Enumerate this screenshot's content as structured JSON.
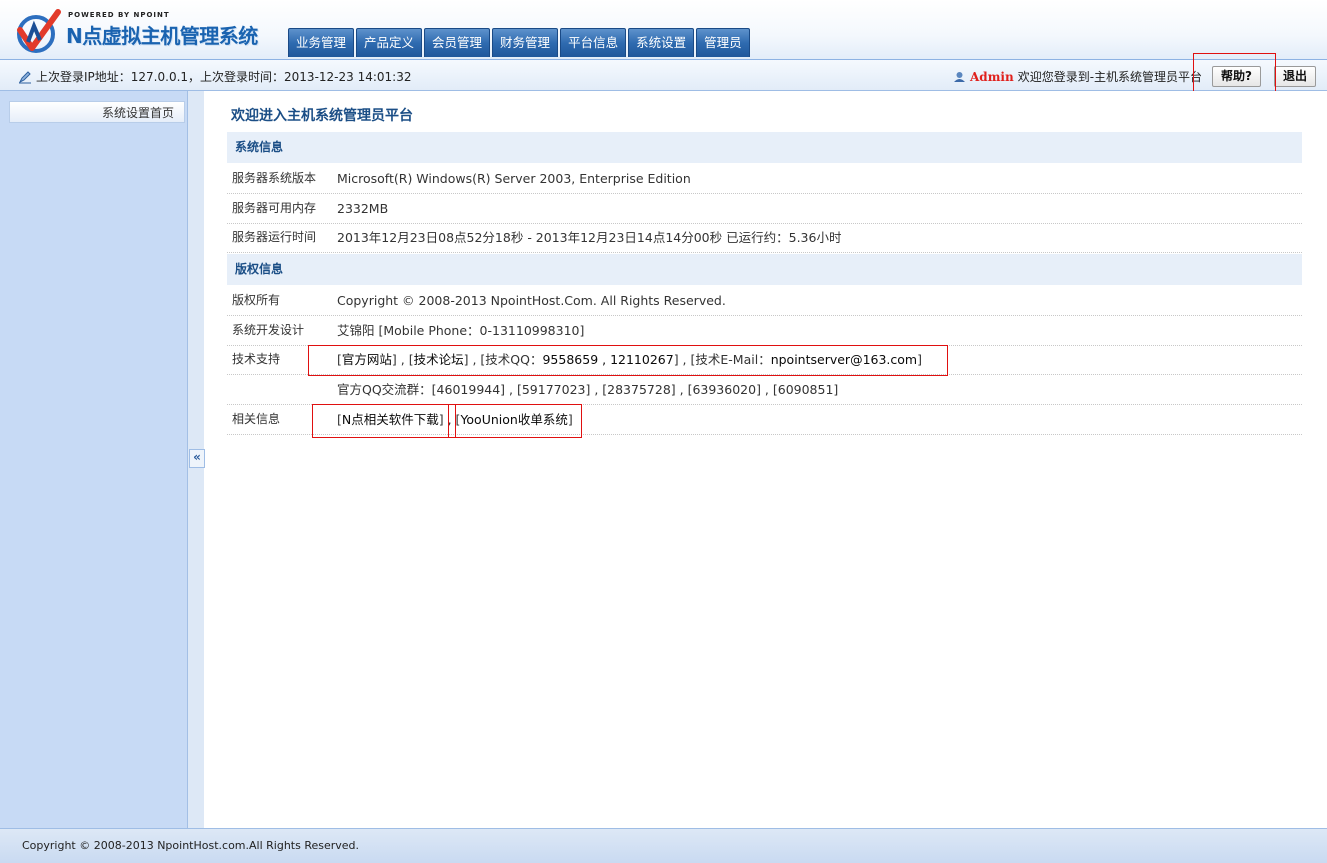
{
  "header": {
    "powered_by": "POWERED BY NPOINT",
    "app_title": "N点虚拟主机管理系统",
    "nav": [
      "业务管理",
      "产品定义",
      "会员管理",
      "财务管理",
      "平台信息",
      "系统设置",
      "管理员"
    ]
  },
  "infobar": {
    "last_login_text": "上次登录IP地址：127.0.0.1，上次登录时间：2013-12-23 14:01:32",
    "admin_name": "Admin",
    "welcome_text": "欢迎您登录到-主机系统管理员平台",
    "help_label": "帮助?",
    "logout_label": "退出"
  },
  "sidebar": {
    "items": [
      "系统设置首页"
    ],
    "collapse_label": "«"
  },
  "main": {
    "title": "欢迎进入主机系统管理员平台",
    "system_section": "系统信息",
    "system_rows": [
      {
        "label": "服务器系统版本",
        "value": "Microsoft(R) Windows(R) Server 2003, Enterprise Edition"
      },
      {
        "label": "服务器可用内存",
        "value": "2332MB"
      },
      {
        "label": "服务器运行时间",
        "value": "2013年12月23日08点52分18秒 - 2013年12月23日14点14分00秒 已运行约：5.36小时"
      }
    ],
    "copyright_section": "版权信息",
    "copyright_rows": [
      {
        "label": "版权所有",
        "value": "Copyright © 2008-2013 NpointHost.Com. All Rights Reserved."
      },
      {
        "label": "系统开发设计",
        "value": "艾锦阳 [Mobile Phone：0-13110998310]"
      }
    ],
    "support": {
      "label": "技术支持",
      "official_site": "官方网站",
      "forum": "技术论坛",
      "qq_prefix": "技术QQ：",
      "qq_numbers": "9558659 , 12110267",
      "email_prefix": "技术E-Mail：",
      "email": "npointserver@163.com",
      "qq_groups": "官方QQ交流群：[46019944] , [59177023] , [28375728] , [63936020] , [6090851]"
    },
    "related": {
      "label": "相关信息",
      "download": "N点相关软件下载",
      "yoounion": "YooUnion收单系统"
    }
  },
  "footer": {
    "copyright": "Copyright © 2008-2013 NpointHost.com.All Rights Reserved."
  }
}
